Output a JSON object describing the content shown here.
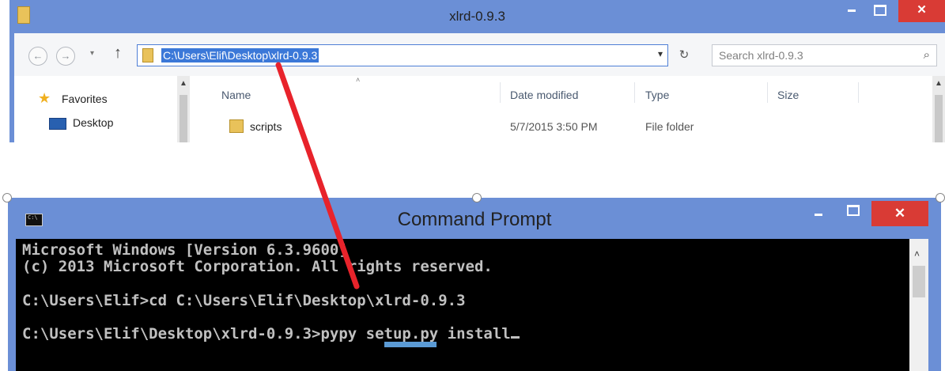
{
  "explorer": {
    "title": "xlrd-0.9.3",
    "close_glyph": "✕",
    "address": "C:\\Users\\Elif\\Desktop\\xlrd-0.9.3",
    "search_placeholder": "Search xlrd-0.9.3",
    "nav": {
      "back_glyph": "←",
      "forward_glyph": "→",
      "recent_glyph": "▾",
      "up_glyph": "↑",
      "refresh_glyph": "↻",
      "search_glyph": "⌕"
    },
    "sidebar": {
      "favorites_label": "Favorites",
      "desktop_label": "Desktop"
    },
    "columns": {
      "name": "Name",
      "date_modified": "Date modified",
      "type": "Type",
      "size": "Size"
    },
    "rows": [
      {
        "name": "scripts",
        "date_modified": "5/7/2015 3:50 PM",
        "type": "File folder",
        "size": ""
      }
    ]
  },
  "cmd": {
    "title": "Command Prompt",
    "icon_text": "C:\\",
    "close_glyph": "✕",
    "lines": [
      "Microsoft Windows [Version 6.3.9600]",
      "(c) 2013 Microsoft Corporation. All rights reserved.",
      "C:\\Users\\Elif>cd C:\\Users\\Elif\\Desktop\\xlrd-0.9.3",
      "C:\\Users\\Elif\\Desktop\\xlrd-0.9.3>pypy setup.py install"
    ]
  },
  "colors": {
    "title_bar": "#6b8fd6",
    "close_button": "#d93b35",
    "address_highlight": "#3b78d8",
    "annotation_arrow": "#e8232b",
    "annotation_underline": "#5b9bd5",
    "console_text": "#c0c0c0"
  }
}
